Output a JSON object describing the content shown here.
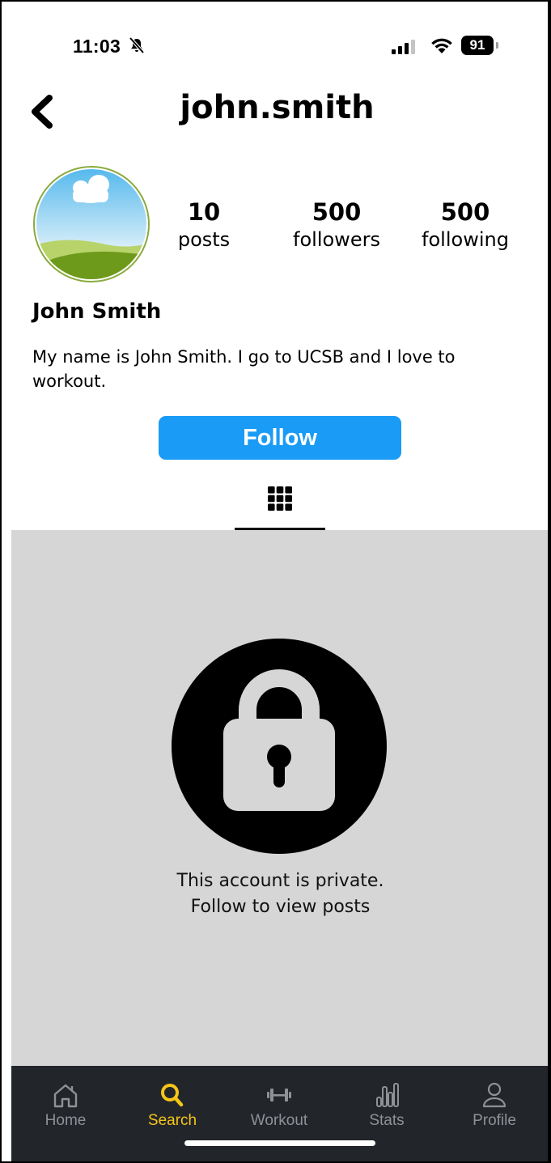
{
  "status_bar": {
    "time": "11:03",
    "battery": "91",
    "icons": [
      "bell-slash-icon",
      "signal-icon",
      "wifi-icon",
      "battery-icon"
    ]
  },
  "header": {
    "username": "john.smith",
    "back_icon": "chevron-left-icon"
  },
  "profile": {
    "stats": [
      {
        "value": "10",
        "label": "posts"
      },
      {
        "value": "500",
        "label": "followers"
      },
      {
        "value": "500",
        "label": "following"
      }
    ],
    "display_name": "John Smith",
    "bio": "My name is John Smith. I go to UCSB and I love to workout.",
    "follow_label": "Follow"
  },
  "tabs": {
    "grid_icon": "grid-icon"
  },
  "private": {
    "message": "This account is private.\n Follow to view posts",
    "icon": "lock-icon"
  },
  "bottom_nav": {
    "items": [
      {
        "label": "Home",
        "icon": "home-icon"
      },
      {
        "label": "Search",
        "icon": "search-icon"
      },
      {
        "label": "Workout",
        "icon": "dumbbell-icon"
      },
      {
        "label": "Stats",
        "icon": "bar-chart-icon"
      },
      {
        "label": "Profile",
        "icon": "person-icon"
      }
    ],
    "active_index": 1
  },
  "colors": {
    "follow_button": "#1a9bf5",
    "nav_background": "#22262b",
    "nav_active": "#f5c518",
    "nav_inactive": "#8e9196",
    "private_background": "#d6d6d6"
  }
}
